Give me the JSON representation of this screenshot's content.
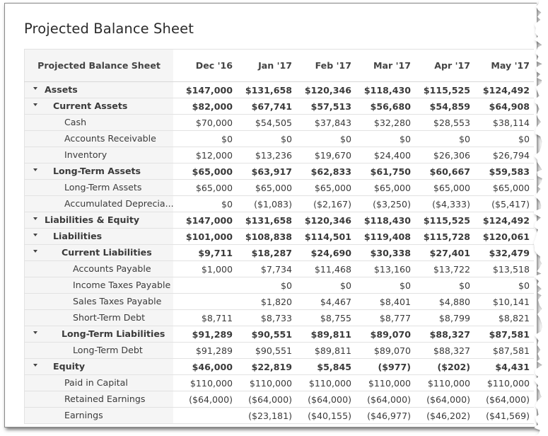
{
  "title": "Projected Balance Sheet",
  "table": {
    "header_label": "Projected Balance Sheet",
    "columns": [
      "Dec '16",
      "Jan '17",
      "Feb '17",
      "Mar '17",
      "Apr '17",
      "May '17"
    ],
    "rows": [
      {
        "label": "Assets",
        "level": 0,
        "bold": true,
        "expandable": true,
        "values": [
          "$147,000",
          "$131,658",
          "$120,346",
          "$118,430",
          "$115,525",
          "$124,492"
        ]
      },
      {
        "label": "Current Assets",
        "level": 1,
        "bold": true,
        "expandable": true,
        "values": [
          "$82,000",
          "$67,741",
          "$57,513",
          "$56,680",
          "$54,859",
          "$64,908"
        ]
      },
      {
        "label": "Cash",
        "level": 2,
        "bold": false,
        "expandable": false,
        "values": [
          "$70,000",
          "$54,505",
          "$37,843",
          "$32,280",
          "$28,553",
          "$38,114"
        ]
      },
      {
        "label": "Accounts Receivable",
        "level": 2,
        "bold": false,
        "expandable": false,
        "values": [
          "$0",
          "$0",
          "$0",
          "$0",
          "$0",
          "$0"
        ]
      },
      {
        "label": "Inventory",
        "level": 2,
        "bold": false,
        "expandable": false,
        "values": [
          "$12,000",
          "$13,236",
          "$19,670",
          "$24,400",
          "$26,306",
          "$26,794"
        ]
      },
      {
        "label": "Long-Term Assets",
        "level": 1,
        "bold": true,
        "expandable": true,
        "values": [
          "$65,000",
          "$63,917",
          "$62,833",
          "$61,750",
          "$60,667",
          "$59,583"
        ]
      },
      {
        "label": "Long-Term Assets",
        "level": 2,
        "bold": false,
        "expandable": false,
        "values": [
          "$65,000",
          "$65,000",
          "$65,000",
          "$65,000",
          "$65,000",
          "$65,000"
        ]
      },
      {
        "label": "Accumulated Deprecia...",
        "level": 2,
        "bold": false,
        "expandable": false,
        "values": [
          "$0",
          "($1,083)",
          "($2,167)",
          "($3,250)",
          "($4,333)",
          "($5,417)"
        ]
      },
      {
        "label": "Liabilities & Equity",
        "level": 0,
        "bold": true,
        "expandable": true,
        "values": [
          "$147,000",
          "$131,658",
          "$120,346",
          "$118,430",
          "$115,525",
          "$124,492"
        ]
      },
      {
        "label": "Liabilities",
        "level": 1,
        "bold": true,
        "expandable": true,
        "values": [
          "$101,000",
          "$108,838",
          "$114,501",
          "$119,408",
          "$115,728",
          "$120,061"
        ]
      },
      {
        "label": "Current Liabilities",
        "level": 2,
        "bold": true,
        "expandable": true,
        "values": [
          "$9,711",
          "$18,287",
          "$24,690",
          "$30,338",
          "$27,401",
          "$32,479"
        ]
      },
      {
        "label": "Accounts Payable",
        "level": 3,
        "bold": false,
        "expandable": false,
        "values": [
          "$1,000",
          "$7,734",
          "$11,468",
          "$13,160",
          "$13,722",
          "$13,518"
        ]
      },
      {
        "label": "Income Taxes Payable",
        "level": 3,
        "bold": false,
        "expandable": false,
        "values": [
          "",
          "$0",
          "$0",
          "$0",
          "$0",
          "$0"
        ]
      },
      {
        "label": "Sales Taxes Payable",
        "level": 3,
        "bold": false,
        "expandable": false,
        "values": [
          "",
          "$1,820",
          "$4,467",
          "$8,401",
          "$4,880",
          "$10,141"
        ]
      },
      {
        "label": "Short-Term Debt",
        "level": 3,
        "bold": false,
        "expandable": false,
        "values": [
          "$8,711",
          "$8,733",
          "$8,755",
          "$8,777",
          "$8,799",
          "$8,821"
        ]
      },
      {
        "label": "Long-Term Liabilities",
        "level": 2,
        "bold": true,
        "expandable": true,
        "values": [
          "$91,289",
          "$90,551",
          "$89,811",
          "$89,070",
          "$88,327",
          "$87,581"
        ]
      },
      {
        "label": "Long-Term Debt",
        "level": 3,
        "bold": false,
        "expandable": false,
        "values": [
          "$91,289",
          "$90,551",
          "$89,811",
          "$89,070",
          "$88,327",
          "$87,581"
        ]
      },
      {
        "label": "Equity",
        "level": 1,
        "bold": true,
        "expandable": true,
        "values": [
          "$46,000",
          "$22,819",
          "$5,845",
          "($977)",
          "($202)",
          "$4,431"
        ]
      },
      {
        "label": "Paid in Capital",
        "level": 2,
        "bold": false,
        "expandable": false,
        "values": [
          "$110,000",
          "$110,000",
          "$110,000",
          "$110,000",
          "$110,000",
          "$110,000"
        ]
      },
      {
        "label": "Retained Earnings",
        "level": 2,
        "bold": false,
        "expandable": false,
        "values": [
          "($64,000)",
          "($64,000)",
          "($64,000)",
          "($64,000)",
          "($64,000)",
          "($64,000)"
        ]
      },
      {
        "label": "Earnings",
        "level": 2,
        "bold": false,
        "expandable": false,
        "values": [
          "",
          "($23,181)",
          "($40,155)",
          "($46,977)",
          "($46,202)",
          "($41,569)"
        ]
      }
    ]
  }
}
